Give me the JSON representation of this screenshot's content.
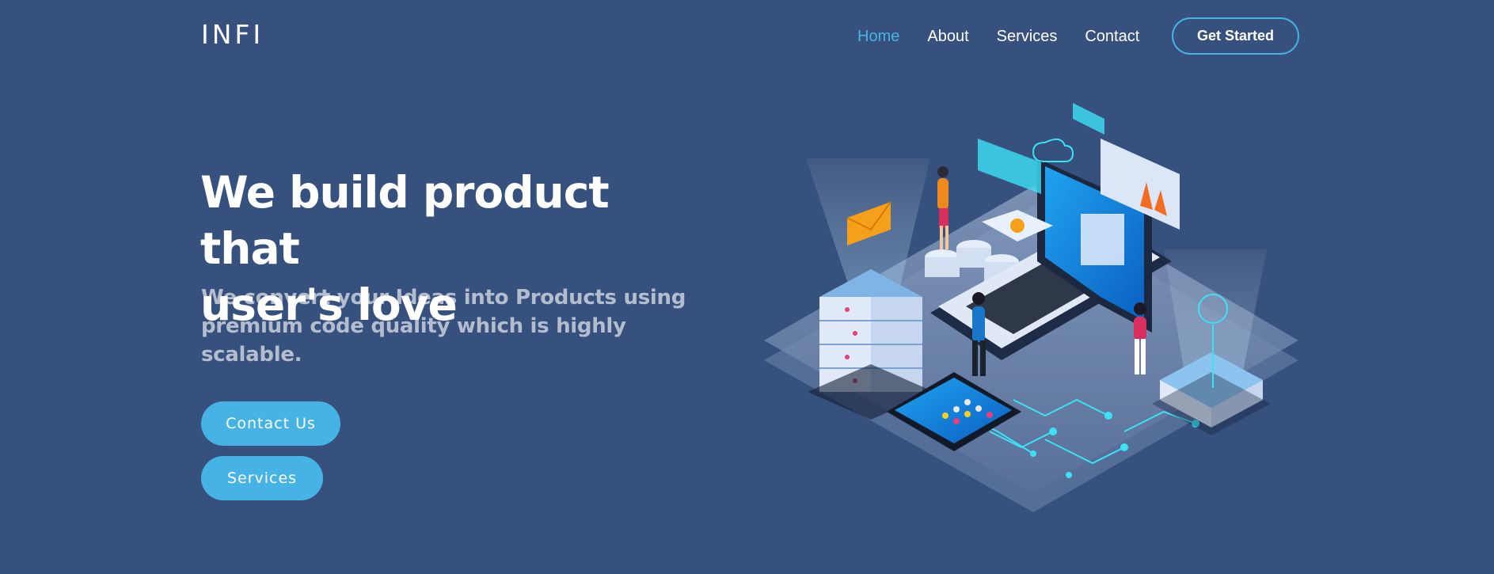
{
  "header": {
    "logo": "INFI",
    "nav": [
      {
        "label": "Home",
        "active": true
      },
      {
        "label": "About",
        "active": false
      },
      {
        "label": "Services",
        "active": false
      },
      {
        "label": "Contact",
        "active": false
      }
    ],
    "cta_label": "Get Started"
  },
  "hero": {
    "title_line1": "We build product that",
    "title_line2": "user's love",
    "subtitle_line1": "We convert your Ideas into Products using",
    "subtitle_line2": "premium code quality which is highly scalable.",
    "contact_button": "Contact Us",
    "services_button": "Services",
    "illustration_icon": "isometric-tech-illustration"
  },
  "colors": {
    "background": "#37517e",
    "accent": "#47b2e4",
    "text": "#ffffff"
  }
}
